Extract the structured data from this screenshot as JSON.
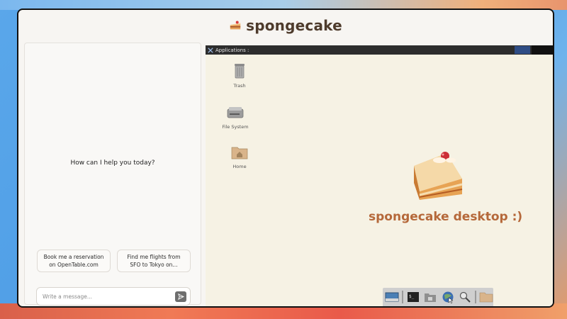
{
  "app": {
    "brand": "spongecake"
  },
  "chat": {
    "greeting": "How can I help you today?",
    "suggestions": [
      "Book me a reservation on OpenTable.com",
      "Find me flights from SFO to Tokyo on..."
    ],
    "input_placeholder": "Write a message...",
    "send_icon": "send-icon"
  },
  "desktop": {
    "panel": {
      "applications_label": "Applications :"
    },
    "icons": [
      {
        "label": "Trash",
        "icon": "trash-icon"
      },
      {
        "label": "File System",
        "icon": "hard-drive-icon"
      },
      {
        "label": "Home",
        "icon": "home-folder-icon"
      }
    ],
    "caption": "spongecake desktop :)",
    "dock": [
      {
        "icon": "desktop-icon"
      },
      {
        "icon": "terminal-icon"
      },
      {
        "icon": "file-manager-icon"
      },
      {
        "icon": "web-browser-icon"
      },
      {
        "icon": "search-icon"
      },
      {
        "icon": "folder-icon"
      }
    ]
  },
  "colors": {
    "brand_text": "#4e3b2c",
    "caption": "#b5683a",
    "panel": "#2d2d2d"
  }
}
